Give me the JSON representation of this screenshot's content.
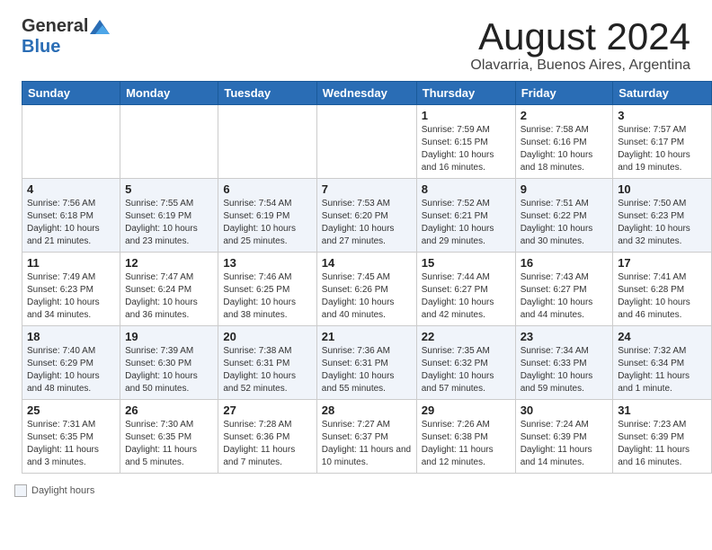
{
  "header": {
    "logo_general": "General",
    "logo_blue": "Blue",
    "month_year": "August 2024",
    "location": "Olavarria, Buenos Aires, Argentina"
  },
  "calendar": {
    "headers": [
      "Sunday",
      "Monday",
      "Tuesday",
      "Wednesday",
      "Thursday",
      "Friday",
      "Saturday"
    ],
    "weeks": [
      [
        {
          "day": "",
          "info": ""
        },
        {
          "day": "",
          "info": ""
        },
        {
          "day": "",
          "info": ""
        },
        {
          "day": "",
          "info": ""
        },
        {
          "day": "1",
          "info": "Sunrise: 7:59 AM\nSunset: 6:15 PM\nDaylight: 10 hours\nand 16 minutes."
        },
        {
          "day": "2",
          "info": "Sunrise: 7:58 AM\nSunset: 6:16 PM\nDaylight: 10 hours\nand 18 minutes."
        },
        {
          "day": "3",
          "info": "Sunrise: 7:57 AM\nSunset: 6:17 PM\nDaylight: 10 hours\nand 19 minutes."
        }
      ],
      [
        {
          "day": "4",
          "info": "Sunrise: 7:56 AM\nSunset: 6:18 PM\nDaylight: 10 hours\nand 21 minutes."
        },
        {
          "day": "5",
          "info": "Sunrise: 7:55 AM\nSunset: 6:19 PM\nDaylight: 10 hours\nand 23 minutes."
        },
        {
          "day": "6",
          "info": "Sunrise: 7:54 AM\nSunset: 6:19 PM\nDaylight: 10 hours\nand 25 minutes."
        },
        {
          "day": "7",
          "info": "Sunrise: 7:53 AM\nSunset: 6:20 PM\nDaylight: 10 hours\nand 27 minutes."
        },
        {
          "day": "8",
          "info": "Sunrise: 7:52 AM\nSunset: 6:21 PM\nDaylight: 10 hours\nand 29 minutes."
        },
        {
          "day": "9",
          "info": "Sunrise: 7:51 AM\nSunset: 6:22 PM\nDaylight: 10 hours\nand 30 minutes."
        },
        {
          "day": "10",
          "info": "Sunrise: 7:50 AM\nSunset: 6:23 PM\nDaylight: 10 hours\nand 32 minutes."
        }
      ],
      [
        {
          "day": "11",
          "info": "Sunrise: 7:49 AM\nSunset: 6:23 PM\nDaylight: 10 hours\nand 34 minutes."
        },
        {
          "day": "12",
          "info": "Sunrise: 7:47 AM\nSunset: 6:24 PM\nDaylight: 10 hours\nand 36 minutes."
        },
        {
          "day": "13",
          "info": "Sunrise: 7:46 AM\nSunset: 6:25 PM\nDaylight: 10 hours\nand 38 minutes."
        },
        {
          "day": "14",
          "info": "Sunrise: 7:45 AM\nSunset: 6:26 PM\nDaylight: 10 hours\nand 40 minutes."
        },
        {
          "day": "15",
          "info": "Sunrise: 7:44 AM\nSunset: 6:27 PM\nDaylight: 10 hours\nand 42 minutes."
        },
        {
          "day": "16",
          "info": "Sunrise: 7:43 AM\nSunset: 6:27 PM\nDaylight: 10 hours\nand 44 minutes."
        },
        {
          "day": "17",
          "info": "Sunrise: 7:41 AM\nSunset: 6:28 PM\nDaylight: 10 hours\nand 46 minutes."
        }
      ],
      [
        {
          "day": "18",
          "info": "Sunrise: 7:40 AM\nSunset: 6:29 PM\nDaylight: 10 hours\nand 48 minutes."
        },
        {
          "day": "19",
          "info": "Sunrise: 7:39 AM\nSunset: 6:30 PM\nDaylight: 10 hours\nand 50 minutes."
        },
        {
          "day": "20",
          "info": "Sunrise: 7:38 AM\nSunset: 6:31 PM\nDaylight: 10 hours\nand 52 minutes."
        },
        {
          "day": "21",
          "info": "Sunrise: 7:36 AM\nSunset: 6:31 PM\nDaylight: 10 hours\nand 55 minutes."
        },
        {
          "day": "22",
          "info": "Sunrise: 7:35 AM\nSunset: 6:32 PM\nDaylight: 10 hours\nand 57 minutes."
        },
        {
          "day": "23",
          "info": "Sunrise: 7:34 AM\nSunset: 6:33 PM\nDaylight: 10 hours\nand 59 minutes."
        },
        {
          "day": "24",
          "info": "Sunrise: 7:32 AM\nSunset: 6:34 PM\nDaylight: 11 hours\nand 1 minute."
        }
      ],
      [
        {
          "day": "25",
          "info": "Sunrise: 7:31 AM\nSunset: 6:35 PM\nDaylight: 11 hours\nand 3 minutes."
        },
        {
          "day": "26",
          "info": "Sunrise: 7:30 AM\nSunset: 6:35 PM\nDaylight: 11 hours\nand 5 minutes."
        },
        {
          "day": "27",
          "info": "Sunrise: 7:28 AM\nSunset: 6:36 PM\nDaylight: 11 hours\nand 7 minutes."
        },
        {
          "day": "28",
          "info": "Sunrise: 7:27 AM\nSunset: 6:37 PM\nDaylight: 11 hours\nand 10 minutes."
        },
        {
          "day": "29",
          "info": "Sunrise: 7:26 AM\nSunset: 6:38 PM\nDaylight: 11 hours\nand 12 minutes."
        },
        {
          "day": "30",
          "info": "Sunrise: 7:24 AM\nSunset: 6:39 PM\nDaylight: 11 hours\nand 14 minutes."
        },
        {
          "day": "31",
          "info": "Sunrise: 7:23 AM\nSunset: 6:39 PM\nDaylight: 11 hours\nand 16 minutes."
        }
      ]
    ]
  },
  "legend": {
    "label": "Daylight hours"
  }
}
